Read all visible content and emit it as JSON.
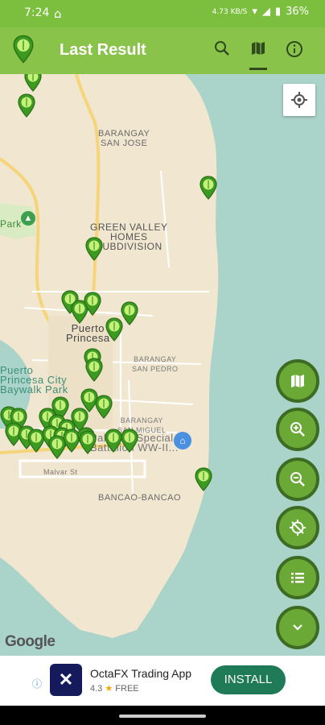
{
  "status_bar": {
    "time": "7:24",
    "home_icon": "home-icon",
    "speed": "4.73 KB/S",
    "battery": "36%"
  },
  "toolbar": {
    "title": "Last Result",
    "app_icon": "green-pin-icon",
    "search_icon": "search-icon",
    "map_icon": "map-icon",
    "info_icon": "info-icon",
    "color": "#8ac34a"
  },
  "map": {
    "labels": {
      "barangay_san_jose": "BARANGAY\nSAN JOSE",
      "green_valley": "GREEN VALLEY\nHOMES\nSUBDIVISION",
      "park": "Park",
      "puerto_princesa": "Puerto\nPrincesa",
      "barangay_san_pedro": "BARANGAY\nSAN PEDRO",
      "baywalk": "Puerto\nPrincesa City\nBaywalk Park",
      "barangay_san_miguel": "BARANGAY\nSAN MIGUEL",
      "battalion": "Palawan Special\nBattalion WW-II...",
      "bancao": "BANCAO-BANCAO",
      "street": "Malvar St"
    },
    "attribution": "Google",
    "location_button_icon": "crosshair-icon"
  },
  "fab_buttons": [
    {
      "name": "map-layers",
      "icon": "map-icon"
    },
    {
      "name": "zoom-in",
      "icon": "zoom-in-icon"
    },
    {
      "name": "zoom-out",
      "icon": "zoom-out-icon"
    },
    {
      "name": "location-off",
      "icon": "gps-off-icon"
    },
    {
      "name": "list",
      "icon": "list-icon"
    },
    {
      "name": "collapse",
      "icon": "chevron-down-icon"
    }
  ],
  "ad": {
    "app_name": "OctaFX Trading App",
    "rating": "4.3",
    "price": "FREE",
    "install_label": "INSTALL"
  }
}
